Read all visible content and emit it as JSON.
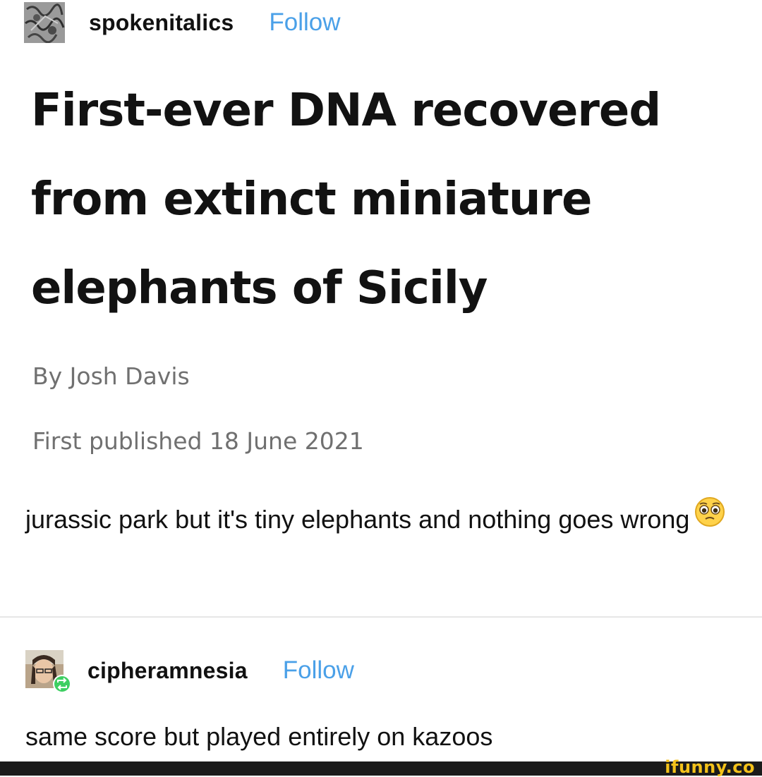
{
  "post": {
    "username": "spokenitalics",
    "follow_label": "Follow",
    "avatar_icon": "sketch-avatar-icon",
    "article": {
      "title": "First-ever DNA recovered from extinct miniature elephants of Sicily",
      "byline": "By Josh Davis",
      "published": "First published 18 June 2021"
    },
    "comment": "jurassic park but it's tiny elephants and nothing goes wrong",
    "comment_emoji": "pleading-face-icon"
  },
  "reblog": {
    "username": "cipheramnesia",
    "follow_label": "Follow",
    "avatar_icon": "photo-avatar-icon",
    "reblog_badge_icon": "reblog-icon",
    "comment": "same score but played entirely on kazoos"
  },
  "footer": {
    "watermark": "ifunny.co"
  },
  "colors": {
    "follow": "#4aa0e8",
    "reblog_badge": "#3ecf62",
    "watermark": "#f4c21a"
  }
}
